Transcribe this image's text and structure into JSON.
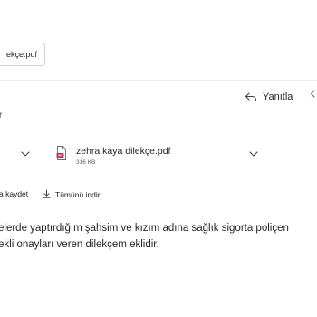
{
  "top": {
    "attachment_tab": "ekçe.pdf"
  },
  "toolbar": {
    "reply_label": "Yanıtla"
  },
  "header": {
    "truncated_label": "r"
  },
  "attachment": {
    "name": "zehra kaya dilekçe.pdf",
    "size": "316 KB",
    "icon": "pdf-file-icon"
  },
  "actions": {
    "save_label": "a kaydet",
    "download_all_label": "Tümünü indir"
  },
  "message": {
    "line1": "elerde yaptırdığım şahsim ve kızım adına sağlık sigorta poliçen",
    "line2": "ekli onayları veren dilekçem eklidir."
  },
  "colors": {
    "accent": "#6b5bd6",
    "pdf_red": "#c4314b"
  }
}
